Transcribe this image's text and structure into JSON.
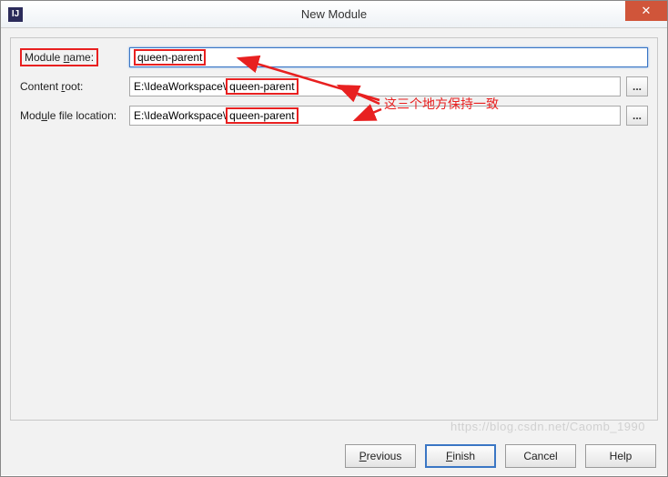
{
  "window": {
    "title": "New Module",
    "close_glyph": "✕"
  },
  "fields": {
    "module_name": {
      "label_pre": "Module ",
      "label_mn": "n",
      "label_post": "ame:",
      "value": "queen-parent"
    },
    "content_root": {
      "label_pre": "Content ",
      "label_mn": "r",
      "label_post": "oot:",
      "prefix": "E:\\IdeaWorkspace\\",
      "highlight": "queen-parent"
    },
    "module_file_location": {
      "label_pre": "Mod",
      "label_mn": "u",
      "label_post": "le file location:",
      "prefix": "E:\\IdeaWorkspace\\",
      "highlight": "queen-parent"
    },
    "browse_glyph": "..."
  },
  "annotation": {
    "text": "这三个地方保持一致"
  },
  "buttons": {
    "previous": {
      "mn": "P",
      "rest": "revious"
    },
    "finish": {
      "mn": "F",
      "rest": "inish"
    },
    "cancel": {
      "text": "Cancel"
    },
    "help": {
      "text": "Help"
    }
  },
  "watermark": "https://blog.csdn.net/Caomb_1990"
}
